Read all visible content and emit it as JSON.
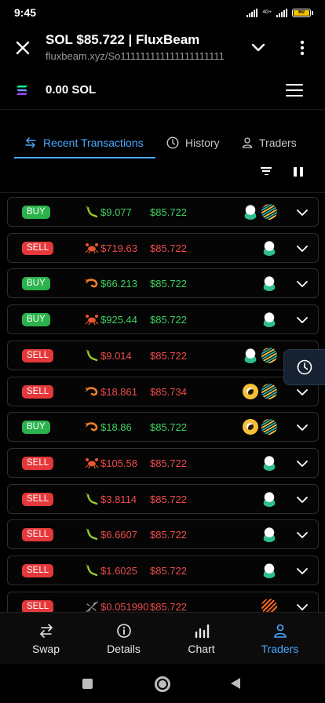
{
  "status_bar": {
    "time": "9:45",
    "network": "4G+",
    "battery": "60"
  },
  "browser": {
    "title": "SOL $85.722 | FluxBeam",
    "url": "fluxbeam.xyz/So111111111111111111111"
  },
  "app": {
    "balance": "0.00 SOL"
  },
  "tabs": [
    {
      "label": "Recent Transactions",
      "active": true
    },
    {
      "label": "History",
      "active": false
    },
    {
      "label": "Traders",
      "active": false
    }
  ],
  "transactions": [
    {
      "type": "BUY",
      "size": "shrimp-plant",
      "usd": "$9.077",
      "price": "$85.722",
      "dex": [
        "pump",
        "meteora"
      ]
    },
    {
      "type": "SELL",
      "size": "crab",
      "usd": "$719.63",
      "price": "$85.722",
      "dex": [
        "pump"
      ]
    },
    {
      "type": "BUY",
      "size": "shrimp",
      "usd": "$66.213",
      "price": "$85.722",
      "dex": [
        "pump"
      ]
    },
    {
      "type": "BUY",
      "size": "crab",
      "usd": "$925.44",
      "price": "$85.722",
      "dex": [
        "pump"
      ]
    },
    {
      "type": "SELL",
      "size": "shrimp-plant",
      "usd": "$9.014",
      "price": "$85.722",
      "dex": [
        "pump",
        "meteora"
      ]
    },
    {
      "type": "SELL",
      "size": "shrimp",
      "usd": "$18.861",
      "price": "$85.734",
      "dex": [
        "orca",
        "meteora"
      ]
    },
    {
      "type": "BUY",
      "size": "shrimp",
      "usd": "$18.86",
      "price": "$85.722",
      "dex": [
        "orca",
        "meteora"
      ]
    },
    {
      "type": "SELL",
      "size": "crab",
      "usd": "$105.58",
      "price": "$85.722",
      "dex": [
        "pump"
      ]
    },
    {
      "type": "SELL",
      "size": "shrimp-plant",
      "usd": "$3.8114",
      "price": "$85.722",
      "dex": [
        "pump"
      ]
    },
    {
      "type": "SELL",
      "size": "shrimp-plant",
      "usd": "$6.6607",
      "price": "$85.722",
      "dex": [
        "pump"
      ]
    },
    {
      "type": "SELL",
      "size": "shrimp-plant",
      "usd": "$1.6025",
      "price": "$85.722",
      "dex": [
        "pump"
      ]
    },
    {
      "type": "SELL",
      "size": "mosquito",
      "usd": "$0.051990",
      "price": "$85.722",
      "dex": [
        "fire"
      ]
    }
  ],
  "bottom_nav": [
    {
      "label": "Swap",
      "icon": "swap-icon",
      "active": false
    },
    {
      "label": "Details",
      "icon": "info-icon",
      "active": false
    },
    {
      "label": "Chart",
      "icon": "bar-chart-icon",
      "active": false
    },
    {
      "label": "Traders",
      "icon": "user-icon",
      "active": true
    }
  ],
  "colors": {
    "buy": "#2bb24c",
    "sell": "#e5383b",
    "buy_text": "#3ed15f",
    "sell_text": "#ef4b4b",
    "accent": "#4aa8ff"
  }
}
